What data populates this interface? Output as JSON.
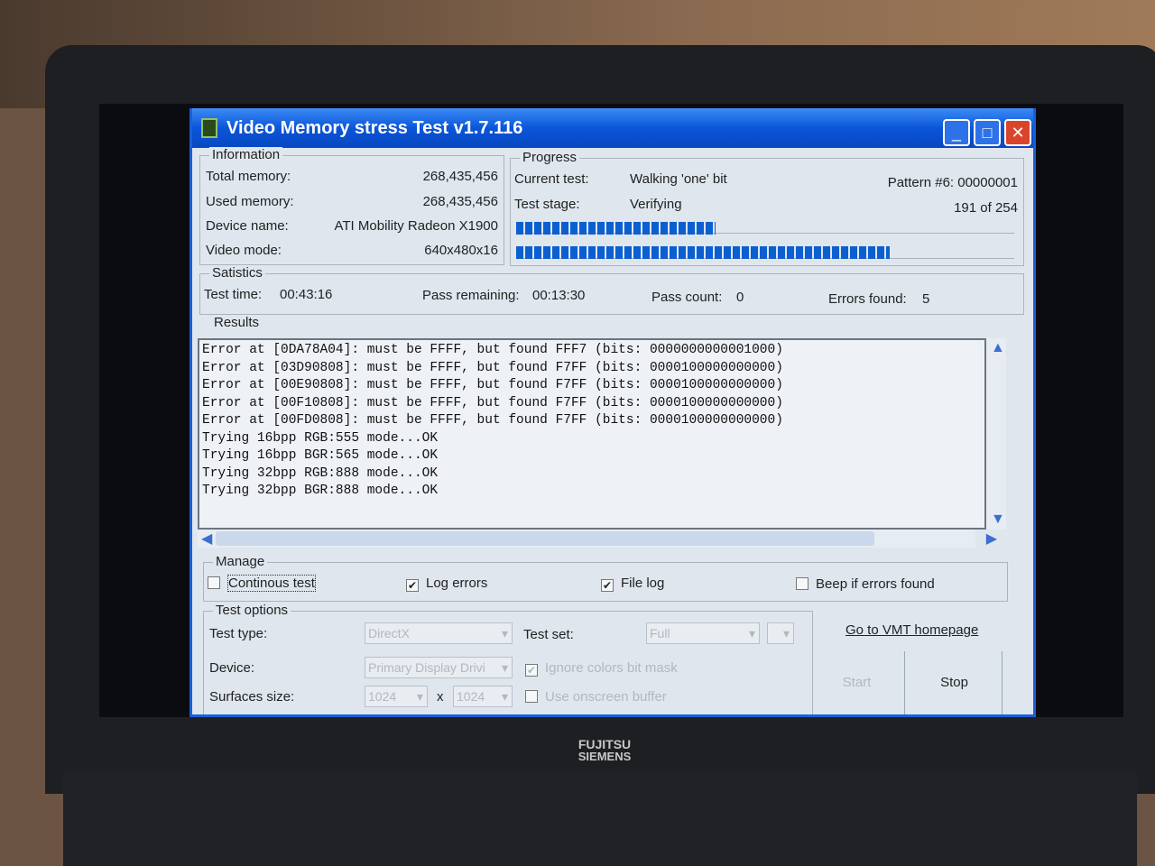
{
  "window": {
    "title": "Video Memory stress Test v1.7.116"
  },
  "information": {
    "legend": "Information",
    "total_label": "Total memory:",
    "total": "268,435,456",
    "used_label": "Used memory:",
    "used": "268,435,456",
    "device_label": "Device name:",
    "device": "ATI Mobility Radeon X1900",
    "mode_label": "Video mode:",
    "mode": "640x480x16"
  },
  "progress": {
    "legend": "Progress",
    "current_label": "Current test:",
    "current": "Walking 'one' bit",
    "pattern": "Pattern #6: 00000001",
    "stage_label": "Test stage:",
    "stage": "Verifying",
    "count": "191 of 254",
    "bar1_fraction": 0.4,
    "bar2_fraction": 0.75
  },
  "statistics": {
    "legend": "Satistics",
    "time_label": "Test time:",
    "time": "00:43:16",
    "remaining_label": "Pass remaining:",
    "remaining": "00:13:30",
    "pass_label": "Pass count:",
    "pass": "0",
    "errors_label": "Errors found:",
    "errors": "5"
  },
  "results": {
    "legend": "Results",
    "lines": [
      "Error at [0DA78A04]: must be FFFF, but found FFF7 (bits: 0000000000001000)",
      "Error at [03D90808]: must be FFFF, but found F7FF (bits: 0000100000000000)",
      "Error at [00E90808]: must be FFFF, but found F7FF (bits: 0000100000000000)",
      "Error at [00F10808]: must be FFFF, but found F7FF (bits: 0000100000000000)",
      "Error at [00FD0808]: must be FFFF, but found F7FF (bits: 0000100000000000)",
      "Trying 16bpp RGB:555 mode...OK",
      "Trying 16bpp BGR:565 mode...OK",
      "Trying 32bpp RGB:888 mode...OK",
      "Trying 32bpp BGR:888 mode...OK"
    ]
  },
  "manage": {
    "legend": "Manage",
    "continuous": "Continous test",
    "log_errors": "Log errors",
    "file_log": "File log",
    "beep": "Beep if errors found",
    "check": "✔"
  },
  "options": {
    "legend": "Test options",
    "type_label": "Test type:",
    "type": "DirectX",
    "set_label": "Test set:",
    "set": "Full",
    "device_label": "Device:",
    "device": "Primary Display Drivi",
    "ignore": "Ignore colors bit mask",
    "surf_label": "Surfaces size:",
    "w": "1024",
    "x": "x",
    "h": "1024",
    "onscreen": "Use onscreen buffer"
  },
  "actions": {
    "homepage": "Go to VMT homepage",
    "start": "Start",
    "stop": "Stop"
  },
  "laptop": {
    "brand1": "FUJITSU",
    "brand2": "SIEMENS"
  }
}
